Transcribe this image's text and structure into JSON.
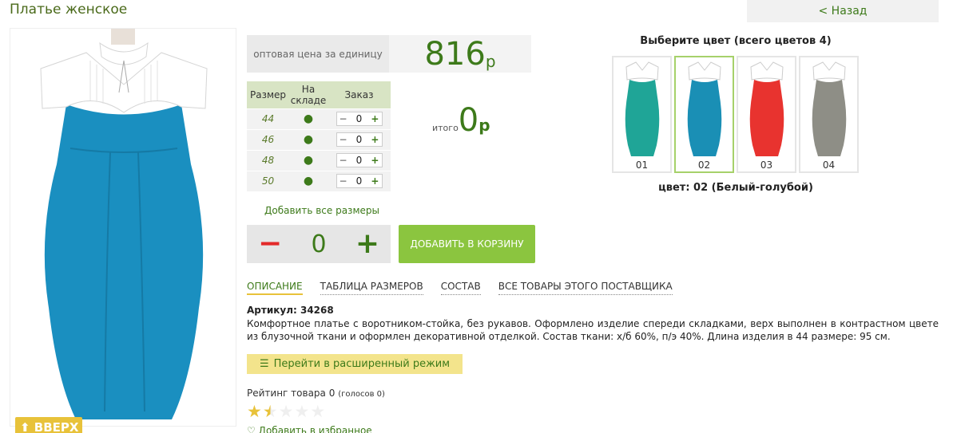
{
  "page": {
    "title": "Платье женское",
    "back_label": "< Назад",
    "top_button_label": "⬆ ВВЕРХ"
  },
  "price": {
    "label": "оптовая цена за единицу",
    "value": "816",
    "currency": "р"
  },
  "sizes": {
    "headers": {
      "size": "Размер",
      "stock": "На складе",
      "order": "Заказ"
    },
    "rows": [
      {
        "size": "44",
        "stock": "●",
        "minus": "−",
        "qty": "0",
        "plus": "+"
      },
      {
        "size": "46",
        "stock": "●",
        "minus": "−",
        "qty": "0",
        "plus": "+"
      },
      {
        "size": "48",
        "stock": "●",
        "minus": "−",
        "qty": "0",
        "plus": "+"
      },
      {
        "size": "50",
        "stock": "●",
        "minus": "−",
        "qty": "0",
        "plus": "+"
      }
    ],
    "add_all_label": "Добавить все размеры"
  },
  "total": {
    "label": "итого",
    "value": "0",
    "currency": "р"
  },
  "quantity": {
    "minus": "−",
    "value": "0",
    "plus": "+"
  },
  "cart_button_label": "ДОБАВИТЬ В КОРЗИНУ",
  "tabs": [
    {
      "label": "ОПИСАНИЕ"
    },
    {
      "label": "ТАБЛИЦА РАЗМЕРОВ"
    },
    {
      "label": "СОСТАВ"
    },
    {
      "label": "ВСЕ ТОВАРЫ ЭТОГО ПОСТАВЩИКА"
    }
  ],
  "article": "Артикул: 34268",
  "description": "Комфортное платье с воротником-стойка, без рукавов. Оформлено изделие спереди складками, верх выполнен в контрастном цвете из блузочной ткани и оформлен декоративной отделкой. Состав ткани: х/б 60%, п/э 40%. Длина изделия в 44 размере: 95 см.",
  "extended_button": {
    "icon": "list-icon",
    "label": "Перейти в расширенный режим"
  },
  "rating": {
    "label": "Рейтинг товара 0",
    "votes": "(голосов 0)",
    "stars_filled": 1.5,
    "stars_total": 5
  },
  "favorite": {
    "icon": "heart-icon",
    "label": "Добавить в избранное"
  },
  "colors": {
    "title": "Выберите цвет (всего цветов 4)",
    "items": [
      {
        "code": "01",
        "color": "#1fa597"
      },
      {
        "code": "02",
        "color": "#1a8fb5"
      },
      {
        "code": "03",
        "color": "#e8332f"
      },
      {
        "code": "04",
        "color": "#8e8e86"
      }
    ],
    "selected_index": 1,
    "current_label": "цвет: 02 (Белый-голубой)"
  }
}
